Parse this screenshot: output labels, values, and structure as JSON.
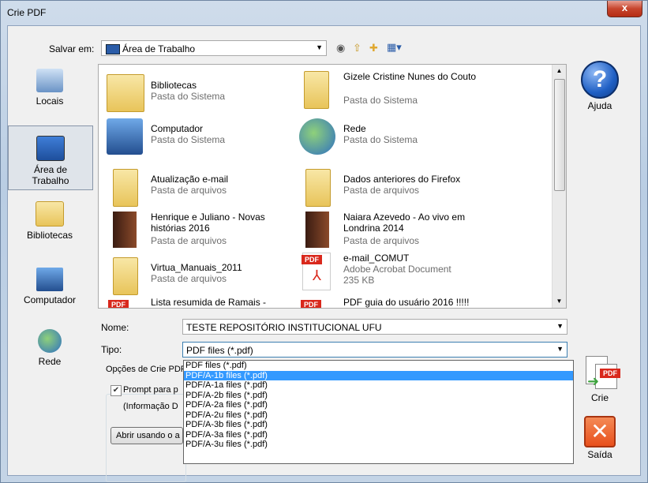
{
  "window": {
    "title": "Crie PDF",
    "close_glyph": "x"
  },
  "toolbar": {
    "save_in_label": "Salvar em:",
    "location": "Área de Trabalho",
    "icons": [
      "back-icon",
      "up-folder-icon",
      "new-folder-icon",
      "view-menu-icon"
    ]
  },
  "places": [
    {
      "label": "Locais",
      "icon": "recent-places-icon"
    },
    {
      "label": "Área de\nTrabalho",
      "icon": "desktop-icon"
    },
    {
      "label": "Bibliotecas",
      "icon": "libraries-icon"
    },
    {
      "label": "Computador",
      "icon": "computer-icon"
    },
    {
      "label": "Rede",
      "icon": "network-icon"
    }
  ],
  "files": [
    {
      "name": "Bibliotecas",
      "type": "Pasta do Sistema",
      "icon": "libraries-icon"
    },
    {
      "name": "Gizele Cristine Nunes do Couto",
      "type": "Pasta do Sistema",
      "icon": "user-folder-icon"
    },
    {
      "name": "Computador",
      "type": "Pasta do Sistema",
      "icon": "computer-icon"
    },
    {
      "name": "Rede",
      "type": "Pasta do Sistema",
      "icon": "network-icon"
    },
    {
      "name": "Atualização e-mail",
      "type": "Pasta de arquivos",
      "icon": "folder-icon"
    },
    {
      "name": "Dados anteriores do Firefox",
      "type": "Pasta de arquivos",
      "icon": "folder-icon"
    },
    {
      "name": "Henrique e Juliano - Novas histórias 2016",
      "type": "Pasta de arquivos",
      "icon": "folder-icon"
    },
    {
      "name": "Naiara Azevedo - Ao vivo em Londrina 2014",
      "type": "Pasta de arquivos",
      "icon": "folder-icon"
    },
    {
      "name": "Virtua_Manuais_2011",
      "type": "Pasta de arquivos",
      "icon": "folder-icon"
    },
    {
      "name": "e-mail_COMUT",
      "type": "Adobe Acrobat Document",
      "size": "235 KB",
      "icon": "pdf-file-icon"
    },
    {
      "name": "Lista resumida de Ramais -",
      "type": "",
      "icon": "pdf-file-icon"
    },
    {
      "name": "PDF guia do usuário 2016 !!!!!",
      "type": "",
      "icon": "pdf-file-icon"
    }
  ],
  "form": {
    "name_label": "Nome:",
    "name_value": "TESTE REPOSITÓRIO INSTITUCIONAL UFU",
    "type_label": "Tipo:",
    "type_value": "PDF files (*.pdf)"
  },
  "type_options": [
    "PDF files (*.pdf)",
    "PDF/A-1b files (*.pdf)",
    "PDF/A-1a files (*.pdf)",
    "PDF/A-2b files (*.pdf)",
    "PDF/A-2a files (*.pdf)",
    "PDF/A-2u files (*.pdf)",
    "PDF/A-3b files (*.pdf)",
    "PDF/A-3a files (*.pdf)",
    "PDF/A-3u files (*.pdf)"
  ],
  "highlighted_option_index": 1,
  "options_group": {
    "title": "Opções de Crie PDF",
    "prompt_label": "Prompt para p",
    "info_label": "(Informação D",
    "open_button": "Abrir usando o a"
  },
  "side": {
    "help": "Ajuda",
    "create": "Crie",
    "exit": "Saída"
  },
  "colors": {
    "accent": "#3399ff",
    "help_blue": "#1f5fc4",
    "exit_orange": "#e8501c"
  }
}
